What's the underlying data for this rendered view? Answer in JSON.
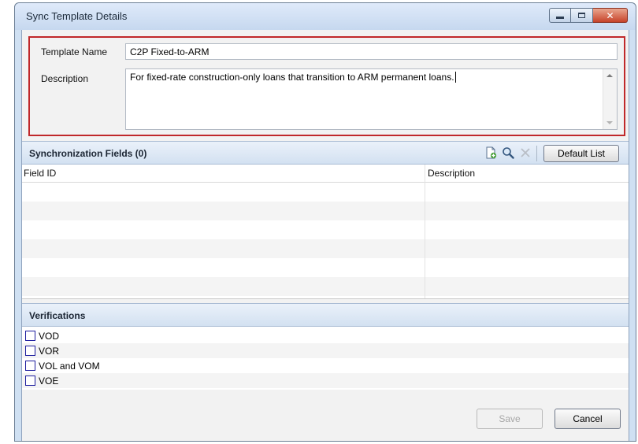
{
  "window": {
    "title": "Sync Template Details",
    "controls": {
      "minimize": "minimize",
      "maximize": "maximize",
      "close": "close"
    }
  },
  "details": {
    "name_label": "Template Name",
    "name_value": "C2P Fixed-to-ARM",
    "description_label": "Description",
    "description_value": "For fixed-rate construction-only loans that transition to ARM permanent loans."
  },
  "sync_fields": {
    "title": "Synchronization Fields (0)",
    "toolbar": {
      "add_icon": "add-document-icon",
      "find_icon": "magnifier-icon",
      "delete_icon": "delete-x-icon"
    },
    "default_list_label": "Default List",
    "columns": [
      "Field ID",
      "Description"
    ],
    "rows": []
  },
  "verifications": {
    "title": "Verifications",
    "items": [
      {
        "label": "VOD",
        "checked": false
      },
      {
        "label": "VOR",
        "checked": false
      },
      {
        "label": "VOL and VOM",
        "checked": false
      },
      {
        "label": "VOE",
        "checked": false
      }
    ]
  },
  "footer": {
    "save_label": "Save",
    "cancel_label": "Cancel"
  },
  "colors": {
    "highlight_border": "#c0282a",
    "section_header": "#d3e1f1",
    "checkbox_border": "#1d1d9e"
  }
}
